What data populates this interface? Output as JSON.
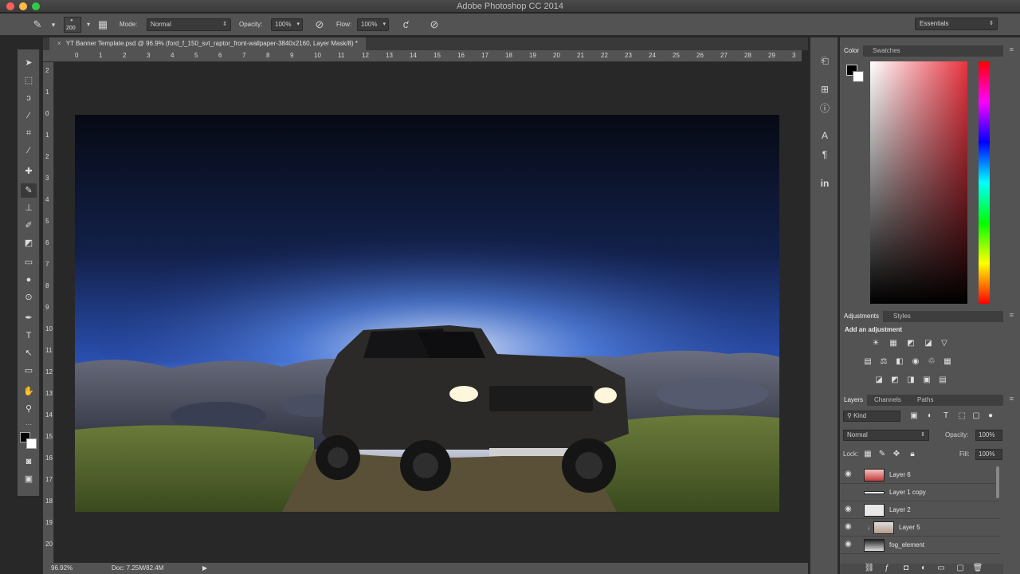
{
  "window": {
    "title": "Adobe Photoshop CC 2014",
    "traffic_colors": [
      "#fc605b",
      "#fdbc40",
      "#34c84a"
    ]
  },
  "options_bar": {
    "brush_size": "200",
    "mode_label": "Mode:",
    "mode_value": "Normal",
    "opacity_label": "Opacity:",
    "opacity_value": "100%",
    "flow_label": "Flow:",
    "flow_value": "100%"
  },
  "workspace": {
    "value": "Essentials"
  },
  "document": {
    "tab_title": "YT Banner Template.psd @ 96.9% (ford_f_150_svt_raptor_front-wallpaper-3840x2160, Layer Mask/8) *",
    "ruler_top": [
      "0",
      "1",
      "2",
      "3",
      "4",
      "5",
      "6",
      "7",
      "8",
      "9",
      "10",
      "11",
      "12",
      "13",
      "14",
      "15",
      "16",
      "17",
      "18",
      "19",
      "20",
      "21",
      "22",
      "23",
      "24",
      "25",
      "26",
      "27",
      "28",
      "29",
      "3"
    ],
    "ruler_left": [
      "2",
      "1",
      "0",
      "1",
      "2",
      "3",
      "4",
      "5",
      "6",
      "7",
      "8",
      "9",
      "10",
      "11",
      "12",
      "13",
      "14",
      "15",
      "16",
      "17",
      "18",
      "19",
      "20"
    ],
    "zoom": "96.92%",
    "doc_size": "Doc: 7.25M/82.4M"
  },
  "color_panel": {
    "tabs": [
      "Color",
      "Swatches"
    ],
    "fg_color": "#000000",
    "bg_color": "#ffffff",
    "hue_color": "#e8333f"
  },
  "adjustments_panel": {
    "tabs": [
      "Adjustments",
      "Styles"
    ],
    "heading": "Add an adjustment"
  },
  "layers_panel": {
    "tabs": [
      "Layers",
      "Channels",
      "Paths"
    ],
    "filter": "Kind",
    "blend_mode": "Normal",
    "opacity_label": "Opacity:",
    "opacity_value": "100%",
    "lock_label": "Lock:",
    "fill_label": "Fill:",
    "fill_value": "100%",
    "layers": [
      {
        "name": "Layer 6"
      },
      {
        "name": "Layer 1 copy"
      },
      {
        "name": "Layer 2"
      },
      {
        "name": "Layer 5"
      },
      {
        "name": "fog_element"
      }
    ]
  }
}
